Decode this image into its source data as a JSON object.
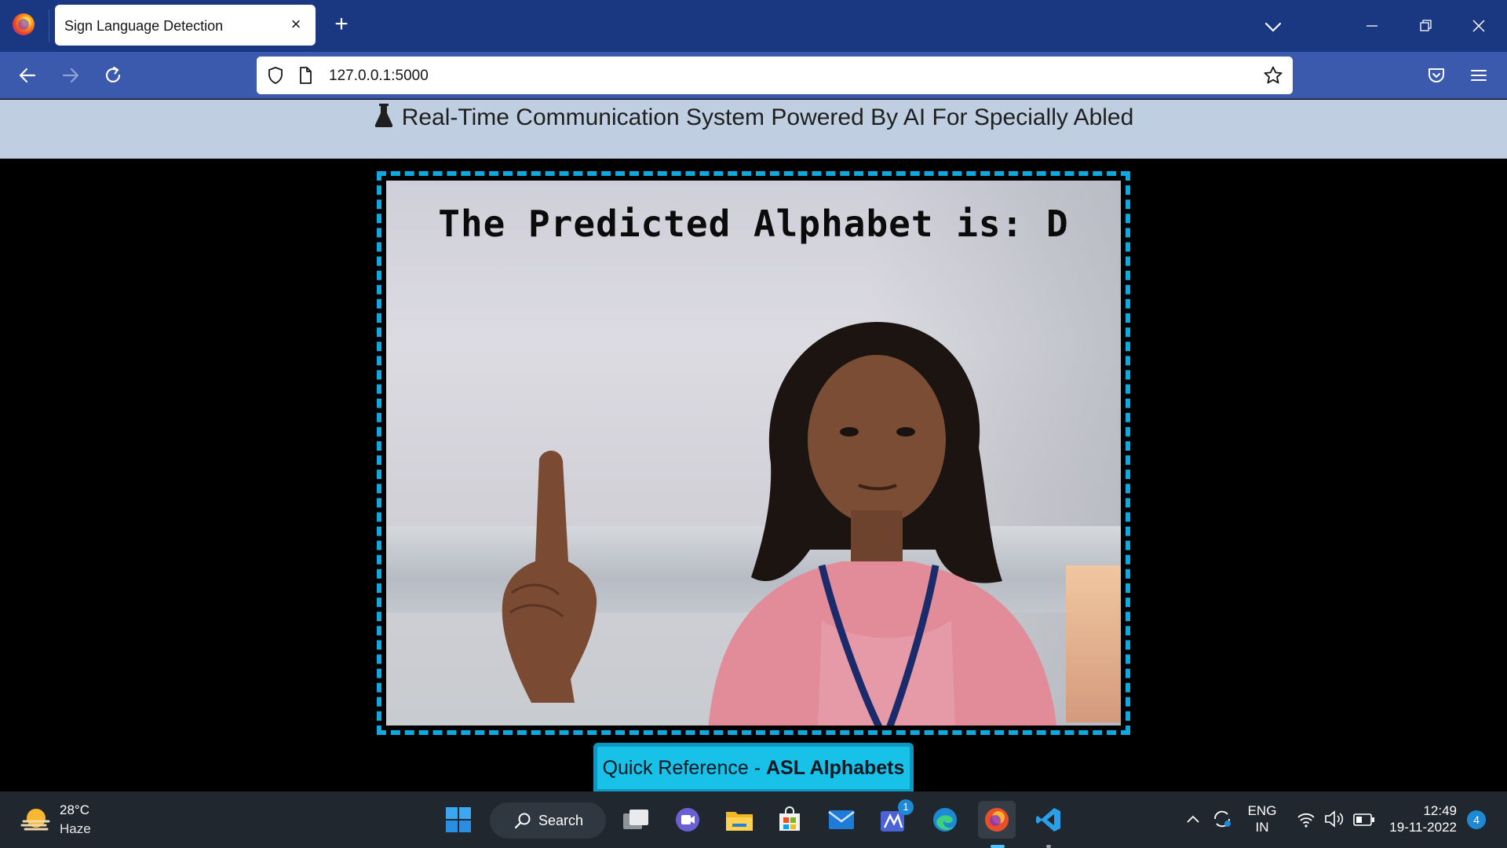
{
  "browser": {
    "tab_title": "Sign Language Detection",
    "tab_close": "×",
    "new_tab": "+",
    "url": "127.0.0.1:5000"
  },
  "page": {
    "header_title": "Real-Time Communication System Powered By AI For Specially Abled",
    "prediction_text": "The Predicted Alphabet is: D",
    "quick_ref_prefix": "Quick Reference - ",
    "quick_ref_bold": "ASL Alphabets"
  },
  "taskbar": {
    "weather_temp": "28°C",
    "weather_condition": "Haze",
    "search_label": "Search",
    "app_badge": "1",
    "lang_line1": "ENG",
    "lang_line2": "IN",
    "time": "12:49",
    "date": "19-11-2022",
    "notification_count": "4"
  },
  "colors": {
    "tabbar": "#1a3781",
    "navbar": "#3b5aad",
    "header_bg": "#bfcfe1",
    "frame_border": "#0fa8df",
    "quickref_bg": "#17c1e8",
    "taskbar": "#20272e"
  },
  "icons": [
    "firefox-icon",
    "close-icon",
    "plus-icon",
    "chevron-down-icon",
    "minimize-icon",
    "restore-icon",
    "back-arrow-icon",
    "forward-arrow-icon",
    "reload-icon",
    "shield-icon",
    "page-icon",
    "star-icon",
    "pocket-icon",
    "hamburger-menu-icon",
    "flask-icon",
    "weather-icon",
    "windows-start-icon",
    "search-icon",
    "task-view-icon",
    "chat-icon",
    "file-explorer-icon",
    "store-icon",
    "mail-icon",
    "edge-icon",
    "vscode-icon",
    "wifi-icon",
    "volume-icon",
    "battery-icon"
  ]
}
